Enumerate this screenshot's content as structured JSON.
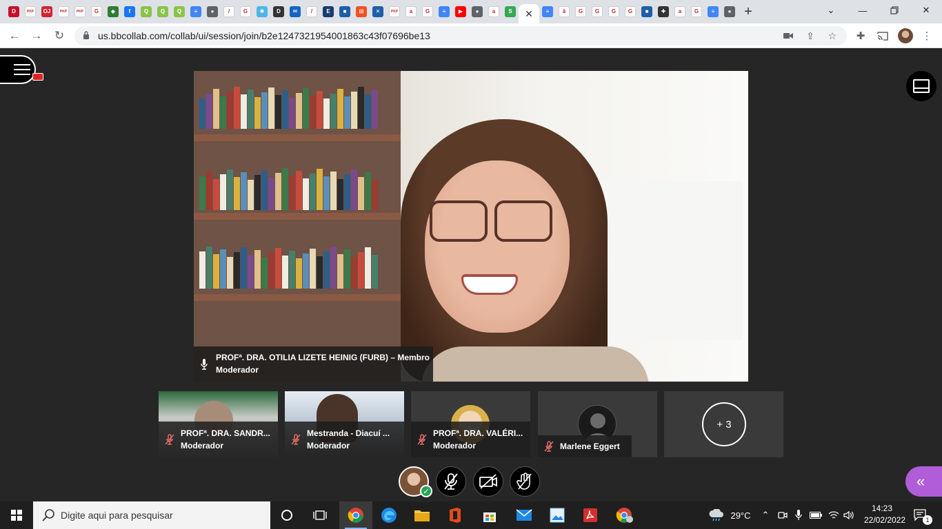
{
  "browser": {
    "tab_favicons": [
      {
        "name": "tab-pinterest",
        "color": "#c8102e",
        "glyph": "D"
      },
      {
        "name": "tab-pkp-1",
        "color": "#ffffff",
        "glyph": "PKP"
      },
      {
        "name": "tab-ojs",
        "color": "#d3232f",
        "glyph": "OJ"
      },
      {
        "name": "tab-pkp-2",
        "color": "#ffffff",
        "glyph": "PKP"
      },
      {
        "name": "tab-pkp-3",
        "color": "#ffffff",
        "glyph": "PKP"
      },
      {
        "name": "tab-google-1",
        "color": "#ffffff",
        "glyph": "G"
      },
      {
        "name": "tab-app-1",
        "color": "#2e7d32",
        "glyph": "◆"
      },
      {
        "name": "tab-facebook",
        "color": "#1877f2",
        "glyph": "f"
      },
      {
        "name": "tab-q-1",
        "color": "#8bc34a",
        "glyph": "Q"
      },
      {
        "name": "tab-q-2",
        "color": "#8bc34a",
        "glyph": "Q"
      },
      {
        "name": "tab-q-3",
        "color": "#8bc34a",
        "glyph": "Q"
      },
      {
        "name": "tab-docs-1",
        "color": "#4285f4",
        "glyph": "≡"
      },
      {
        "name": "tab-globe-1",
        "color": "#5f6368",
        "glyph": "●"
      },
      {
        "name": "tab-pen-1",
        "color": "#ffffff",
        "glyph": "/"
      },
      {
        "name": "tab-google-2",
        "color": "#ffffff",
        "glyph": "G"
      },
      {
        "name": "tab-gear",
        "color": "#4db6e6",
        "glyph": "✺"
      },
      {
        "name": "tab-d",
        "color": "#333333",
        "glyph": "D"
      },
      {
        "name": "tab-mail",
        "color": "#1565c0",
        "glyph": "✉"
      },
      {
        "name": "tab-pen-2",
        "color": "#ffffff",
        "glyph": "/"
      },
      {
        "name": "tab-e",
        "color": "#1a3c6e",
        "glyph": "E"
      },
      {
        "name": "tab-cam-1",
        "color": "#1f5fa8",
        "glyph": "■"
      },
      {
        "name": "tab-microsoft",
        "color": "#f25022",
        "glyph": "⊞"
      },
      {
        "name": "tab-x",
        "color": "#1f5fa8",
        "glyph": "✕"
      },
      {
        "name": "tab-pkp-4",
        "color": "#ffffff",
        "glyph": "PKP"
      },
      {
        "name": "tab-amazon-1",
        "color": "#ffffff",
        "glyph": "a"
      },
      {
        "name": "tab-google-3",
        "color": "#ffffff",
        "glyph": "G"
      },
      {
        "name": "tab-docs-2",
        "color": "#4285f4",
        "glyph": "≡"
      },
      {
        "name": "tab-youtube",
        "color": "#ff0000",
        "glyph": "▶"
      },
      {
        "name": "tab-globe-2",
        "color": "#5f6368",
        "glyph": "●"
      },
      {
        "name": "tab-amazon-2",
        "color": "#ffffff",
        "glyph": "a"
      },
      {
        "name": "tab-s",
        "color": "#34a853",
        "glyph": "S"
      }
    ],
    "tab_favicons_after": [
      {
        "name": "tab-docs-3",
        "color": "#4285f4",
        "glyph": "≡"
      },
      {
        "name": "tab-a",
        "color": "#ffffff",
        "glyph": "ă"
      },
      {
        "name": "tab-google-4",
        "color": "#ffffff",
        "glyph": "G"
      },
      {
        "name": "tab-google-5",
        "color": "#ffffff",
        "glyph": "G"
      },
      {
        "name": "tab-google-6",
        "color": "#ffffff",
        "glyph": "G"
      },
      {
        "name": "tab-google-7",
        "color": "#ffffff",
        "glyph": "G"
      },
      {
        "name": "tab-cam-2",
        "color": "#1f5fa8",
        "glyph": "■"
      },
      {
        "name": "tab-plus",
        "color": "#333333",
        "glyph": "✚"
      },
      {
        "name": "tab-amazon-3",
        "color": "#ffffff",
        "glyph": "a"
      },
      {
        "name": "tab-google-8",
        "color": "#ffffff",
        "glyph": "G"
      },
      {
        "name": "tab-docs-4",
        "color": "#4285f4",
        "glyph": "≡"
      },
      {
        "name": "tab-globe-3",
        "color": "#5f6368",
        "glyph": "●"
      }
    ],
    "active_tab_close": "✕",
    "new_tab": "+",
    "window_controls": {
      "minimize": "⌄",
      "maximize": "🗗",
      "restore": "—",
      "close": "✕"
    },
    "url": "us.bbcollab.com/collab/ui/session/join/b2e1247321954001863c43f07696be13"
  },
  "session": {
    "speaker": {
      "name": "PROFª. DRA. OTILIA LIZETE HEINIG (FURB) – Membro",
      "role": "Moderador"
    },
    "tiles": [
      {
        "name": "PROFª. DRA. SANDR...",
        "role": "Moderador"
      },
      {
        "name": "Mestranda - Diacuí ...",
        "role": "Moderador"
      },
      {
        "name": "PROFª. DRA. VALÉRI...",
        "role": "Moderador"
      },
      {
        "name": "Marlene Eggert",
        "role": ""
      }
    ],
    "more_count": "+ 3"
  },
  "taskbar": {
    "search_placeholder": "Digite aqui para pesquisar",
    "weather": "29°C",
    "time": "14:23",
    "date": "22/02/2022",
    "notifications": "1"
  },
  "colors": {
    "accent_purple": "#b15cd8",
    "check_green": "#27a35a",
    "record_red": "#e02424"
  }
}
